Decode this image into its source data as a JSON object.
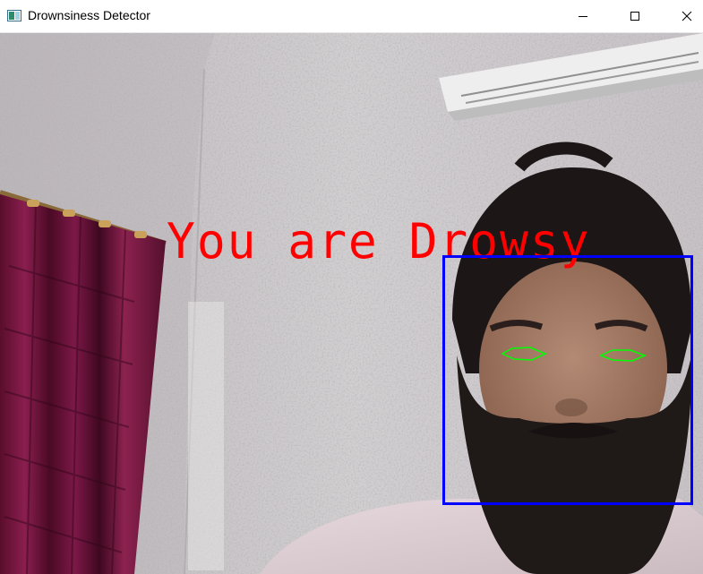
{
  "window": {
    "title": "Drownsiness Detector",
    "controls": {
      "minimize": "minimize",
      "maximize": "maximize",
      "close": "close"
    }
  },
  "video": {
    "status_text": "You are Drowsy",
    "status_color": "#ff0000",
    "face_box_color": "#0000ff",
    "eye_contour_color": "#00ff00",
    "detected_faces": 1,
    "detected_eyes": 2
  },
  "icons": {
    "app": "app-window-icon",
    "minimize": "minimize-icon",
    "maximize": "maximize-icon",
    "close": "close-icon"
  }
}
